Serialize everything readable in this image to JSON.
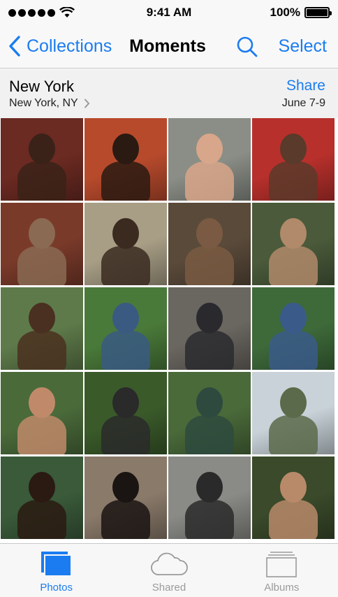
{
  "status_bar": {
    "time": "9:41 AM",
    "battery": "100%"
  },
  "nav": {
    "back_label": "Collections",
    "title": "Moments",
    "select_label": "Select"
  },
  "moment": {
    "title": "New York",
    "location": "New York, NY",
    "share_label": "Share",
    "date_range": "June 7-9"
  },
  "photos": [
    {
      "bg": "#6b2a22",
      "fig": "#3a2218"
    },
    {
      "bg": "#b84a2c",
      "fig": "#2a1a12"
    },
    {
      "bg": "#8a8e86",
      "fig": "#d8a68a"
    },
    {
      "bg": "#b8302c",
      "fig": "#5a3a2a"
    },
    {
      "bg": "#7a3a2a",
      "fig": "#8a6a52"
    },
    {
      "bg": "#a89e86",
      "fig": "#3a2a20"
    },
    {
      "bg": "#5a4a3a",
      "fig": "#7a5a42"
    },
    {
      "bg": "#4a5a3a",
      "fig": "#b08a6a"
    },
    {
      "bg": "#5e7a4a",
      "fig": "#4a3020"
    },
    {
      "bg": "#4a7a3a",
      "fig": "#3a5a82"
    },
    {
      "bg": "#6a6660",
      "fig": "#2a2a2e"
    },
    {
      "bg": "#3e6a3a",
      "fig": "#3a5a8a"
    },
    {
      "bg": "#4a6a3a",
      "fig": "#c08a6a"
    },
    {
      "bg": "#3a5a2a",
      "fig": "#2a2a2a"
    },
    {
      "bg": "#4a6a3a",
      "fig": "#2e4a3e"
    },
    {
      "bg": "#c8d2d8",
      "fig": "#5a6a4a"
    },
    {
      "bg": "#3a5a3a",
      "fig": "#2a1a12"
    },
    {
      "bg": "#8a7a6a",
      "fig": "#1a1412"
    },
    {
      "bg": "#8a8a86",
      "fig": "#2a2a2a"
    },
    {
      "bg": "#3a4a2a",
      "fig": "#b88a6a"
    }
  ],
  "tabs": [
    {
      "label": "Photos",
      "icon": "photos-icon",
      "active": true
    },
    {
      "label": "Shared",
      "icon": "cloud-icon",
      "active": false
    },
    {
      "label": "Albums",
      "icon": "albums-icon",
      "active": false
    }
  ],
  "colors": {
    "accent": "#1a7cf0",
    "inactive": "#9a9a9a"
  }
}
